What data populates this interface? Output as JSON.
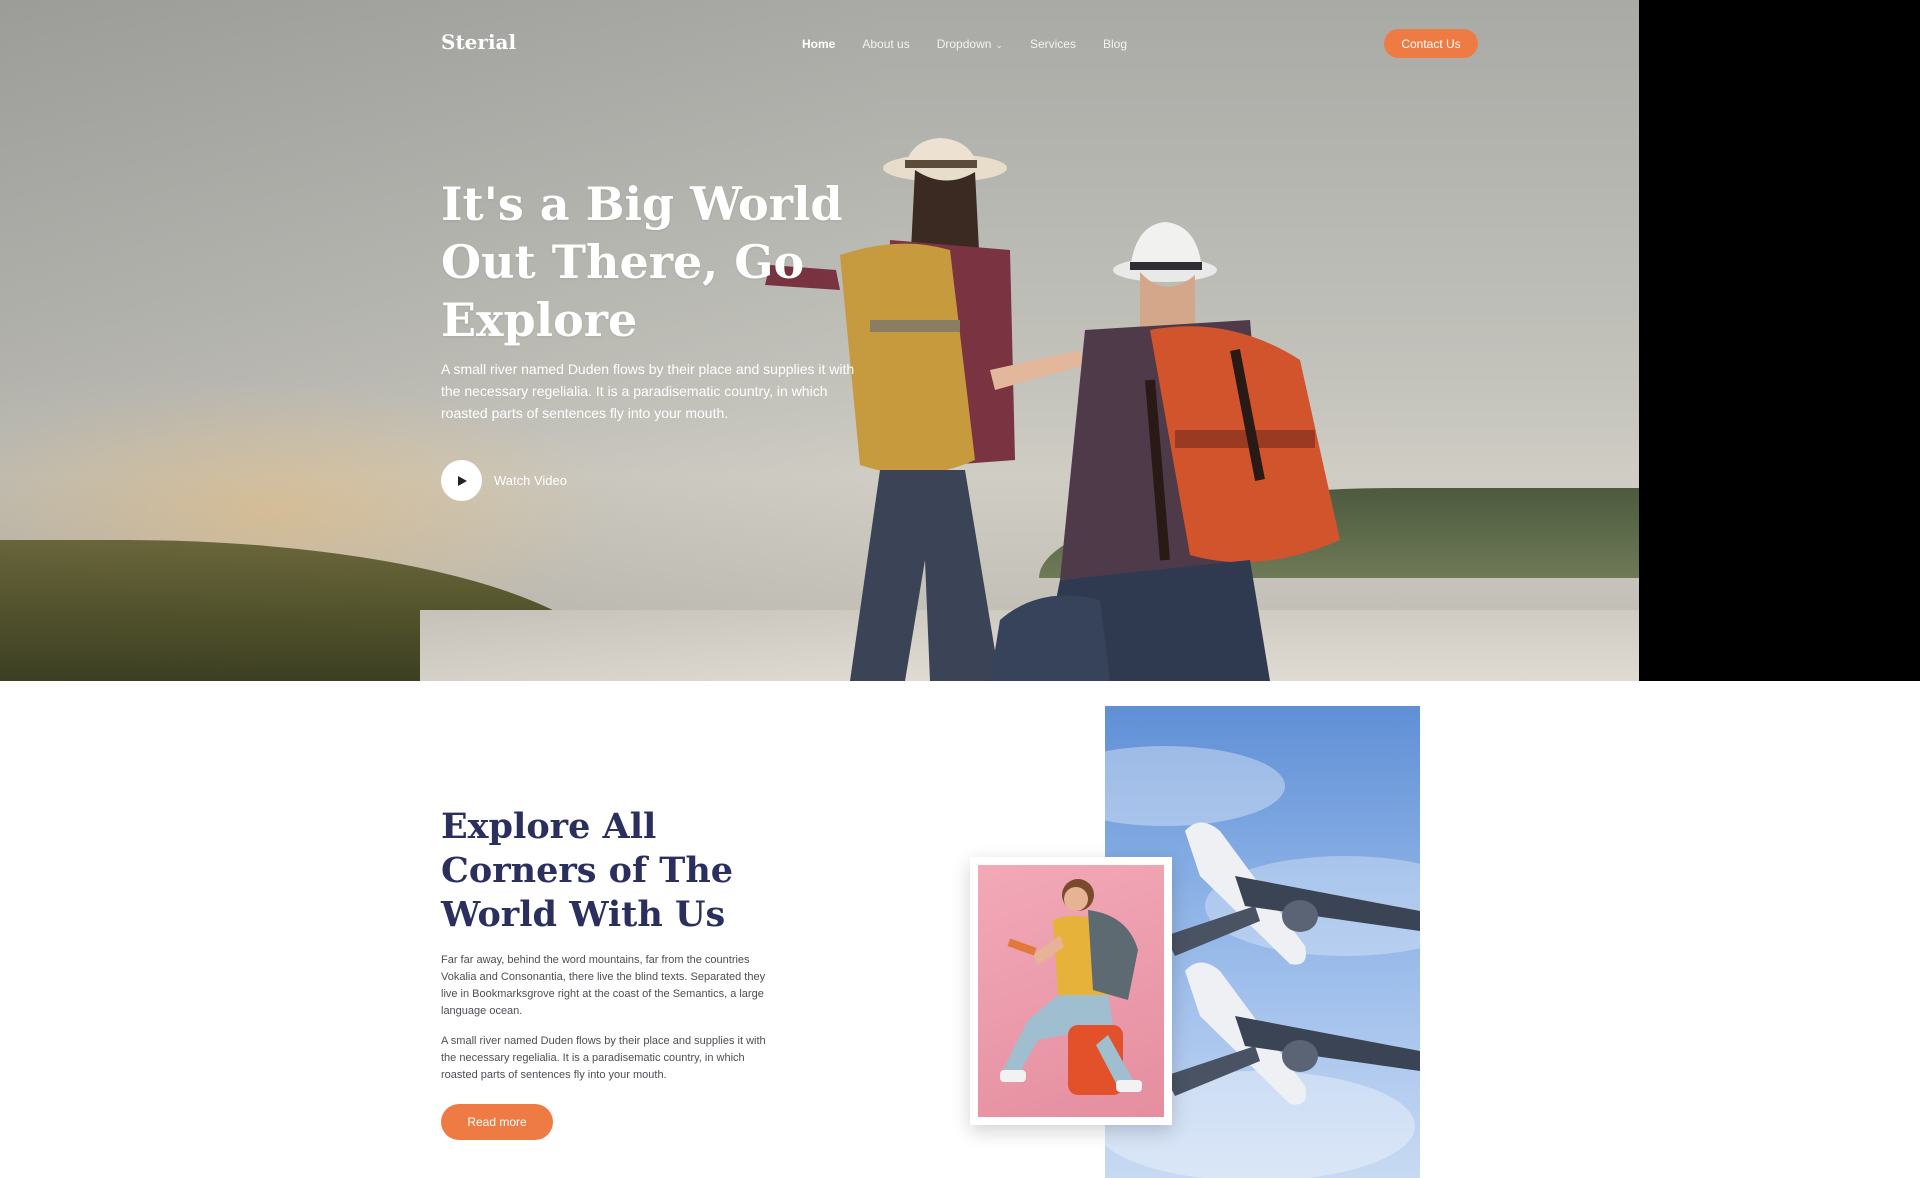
{
  "brand": {
    "logo": "Sterial"
  },
  "nav": {
    "items": [
      {
        "label": "Home",
        "active": true
      },
      {
        "label": "About us"
      },
      {
        "label": "Dropdown",
        "has_caret": true
      },
      {
        "label": "Services"
      },
      {
        "label": "Blog"
      }
    ],
    "contact_button": "Contact Us"
  },
  "hero": {
    "title": "It's a Big World Out There, Go Explore",
    "text": "A small river named Duden flows by their place and supplies it with the necessary regelialia. It is a paradisematic country, in which roasted parts of sentences fly into your mouth.",
    "watch_label": "Watch Video"
  },
  "about": {
    "title": "Explore All Corners of The World With Us",
    "paragraph_1": "Far far away, behind the word mountains, far from the countries Vokalia and Consonantia, there live the blind texts. Separated they live in Bookmarksgrove right at the coast of the Semantics, a large language ocean.",
    "paragraph_2": "A small river named Duden flows by their place and supplies it with the necessary regelialia. It is a paradisematic country, in which roasted parts of sentences fly into your mouth.",
    "read_more": "Read more"
  },
  "colors": {
    "accent": "#ef7b44",
    "heading_dark": "#2b2f5e"
  }
}
